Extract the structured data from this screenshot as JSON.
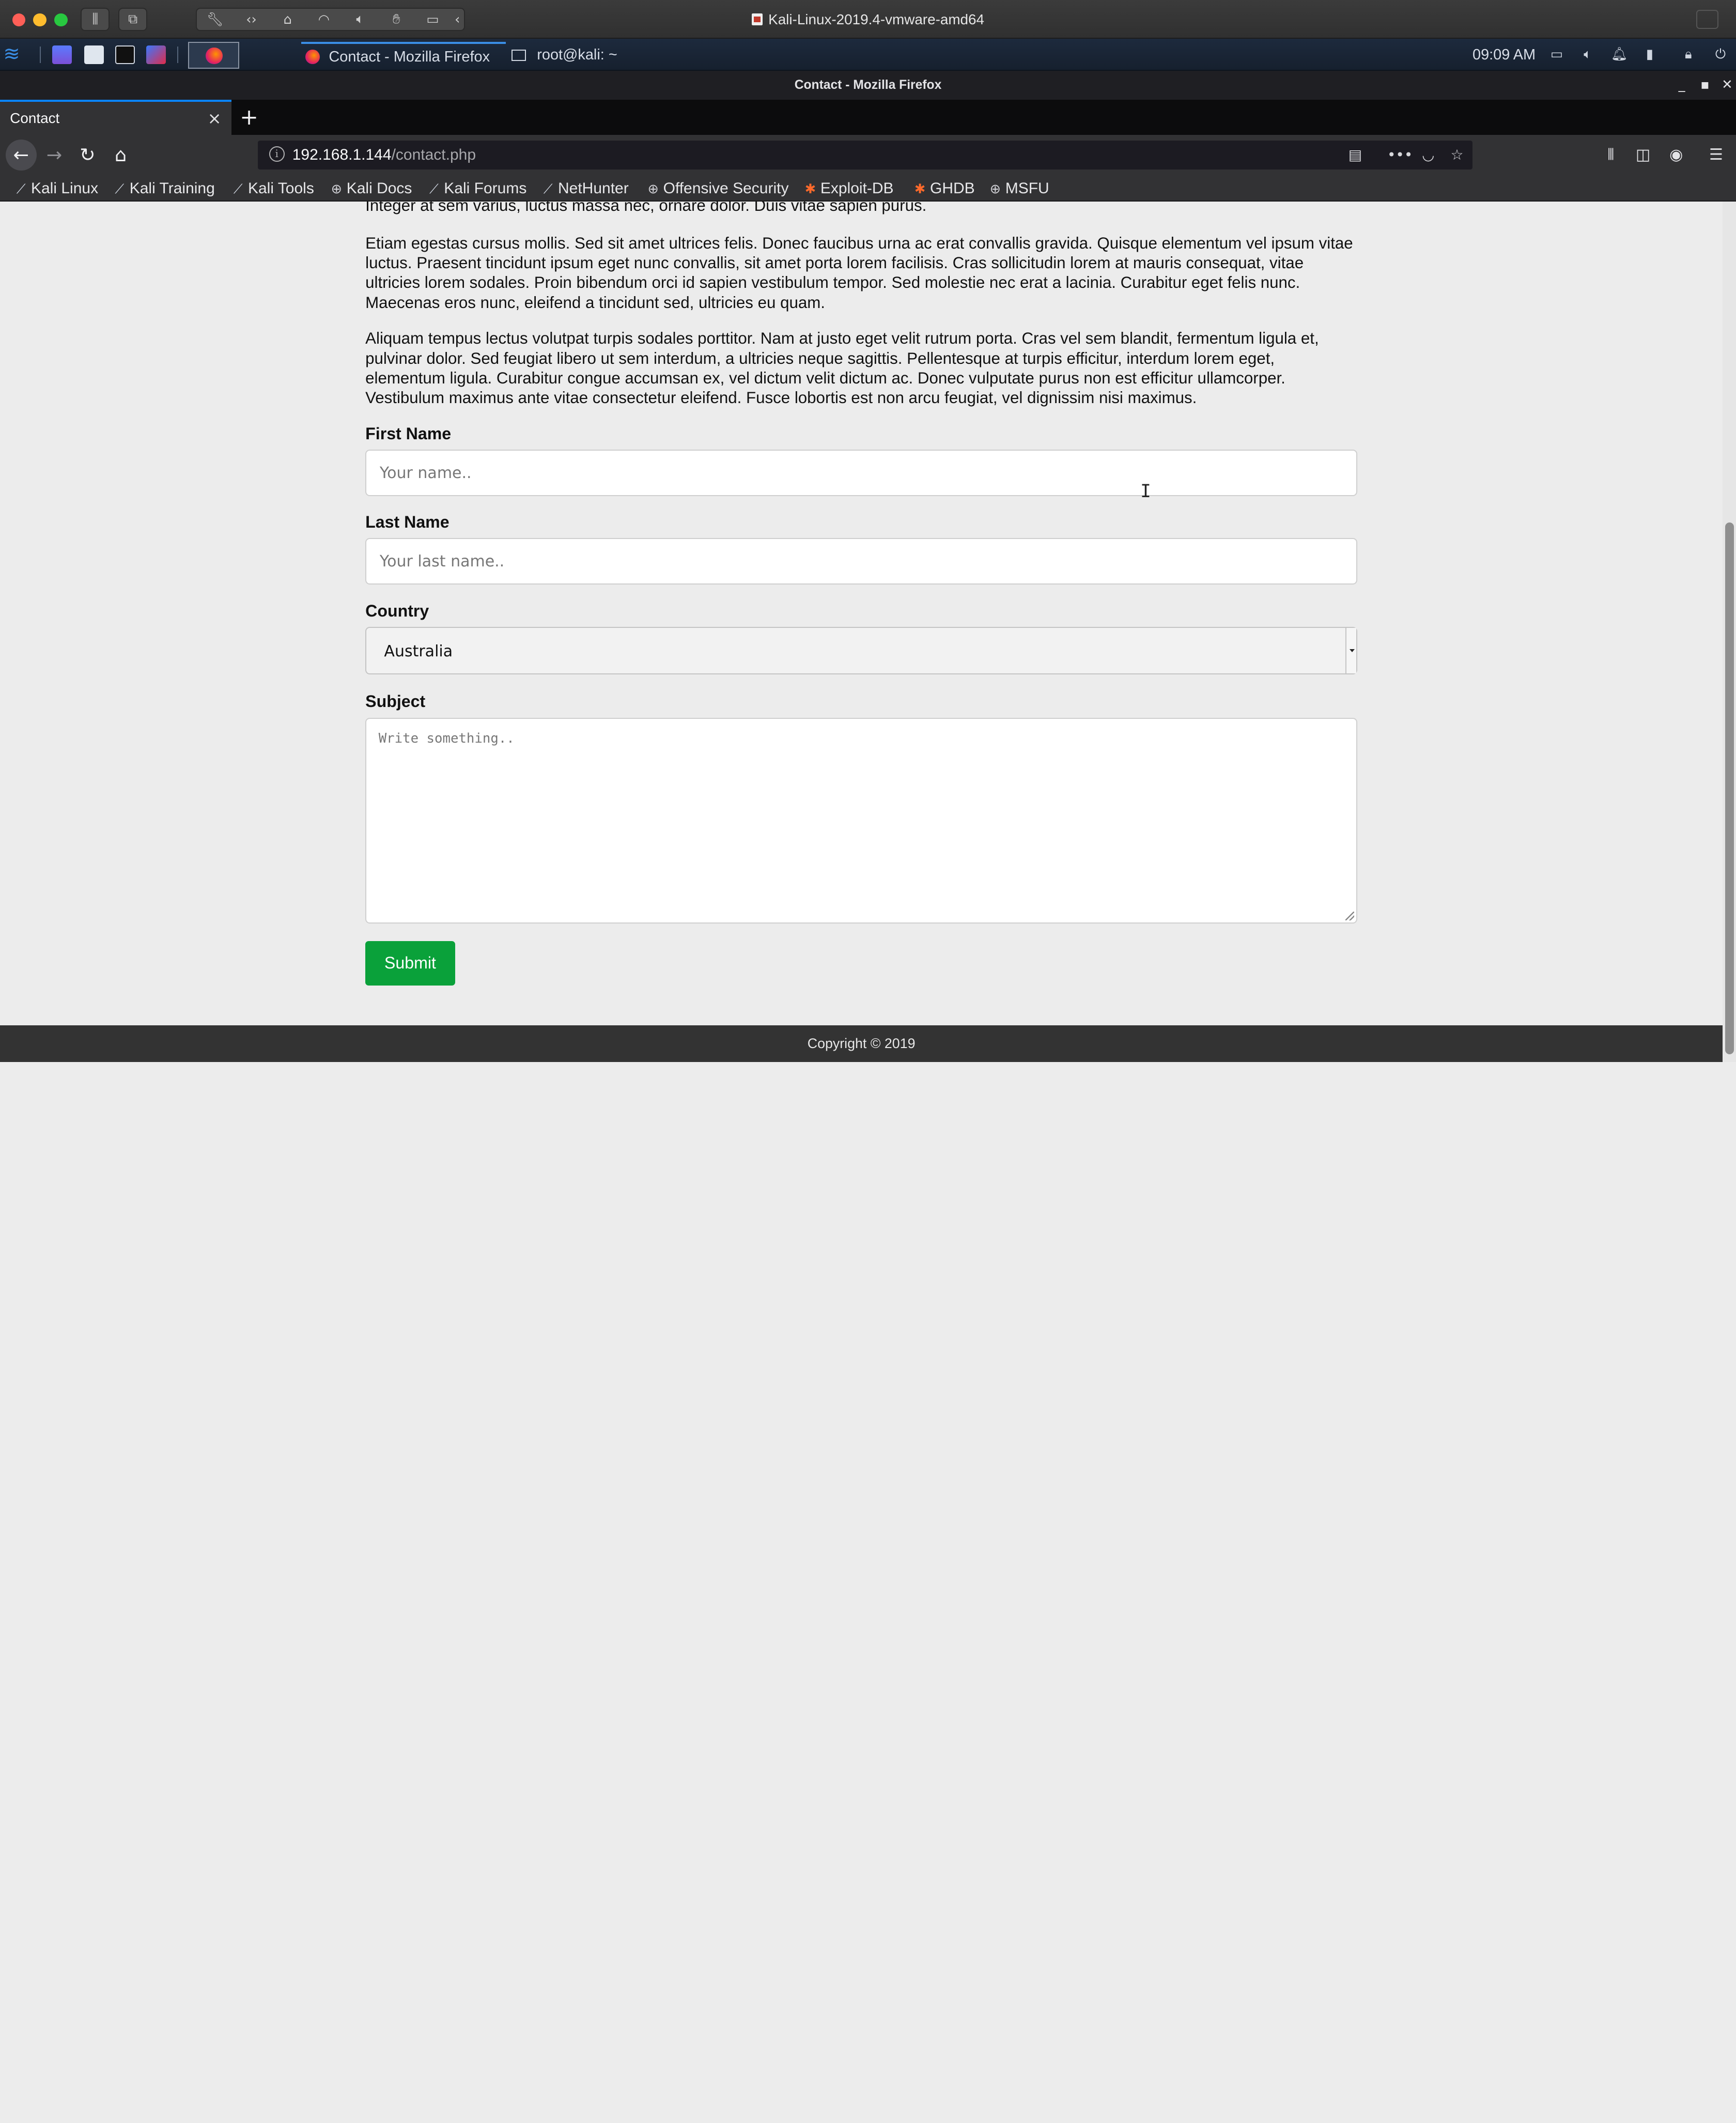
{
  "mac_window": {
    "title": "Kali-Linux-2019.4-vmware-amd64"
  },
  "kali_panel": {
    "tasks": [
      {
        "label": "Contact - Mozilla Firefox"
      },
      {
        "label": "root@kali: ~"
      }
    ],
    "clock": "09:09 AM"
  },
  "firefox": {
    "window_title": "Contact - Mozilla Firefox",
    "tab": {
      "label": "Contact",
      "close": "×"
    },
    "new_tab": "+",
    "url": {
      "host": "192.168.1.144",
      "path": "/contact.php"
    },
    "bookmarks": [
      {
        "label": "Kali Linux",
        "icon": "kali-icon"
      },
      {
        "label": "Kali Training",
        "icon": "kali-icon"
      },
      {
        "label": "Kali Tools",
        "icon": "kali-icon"
      },
      {
        "label": "Kali Docs",
        "icon": "globe-icon"
      },
      {
        "label": "Kali Forums",
        "icon": "kali-icon"
      },
      {
        "label": "NetHunter",
        "icon": "kali-icon"
      },
      {
        "label": "Offensive Security",
        "icon": "globe-icon"
      },
      {
        "label": "Exploit-DB",
        "icon": "bug-icon"
      },
      {
        "label": "GHDB",
        "icon": "bug-icon"
      },
      {
        "label": "MSFU",
        "icon": "globe-icon"
      }
    ]
  },
  "page": {
    "para_cut": "Integer at sem varius, luctus massa nec, ornare dolor. Duis vitae sapien purus.",
    "para1": "Etiam egestas cursus mollis. Sed sit amet ultrices felis. Donec faucibus urna ac erat convallis gravida. Quisque elementum vel ipsum vitae luctus. Praesent tincidunt ipsum eget nunc convallis, sit amet porta lorem facilisis. Cras sollicitudin lorem at mauris consequat, vitae ultricies lorem sodales. Proin bibendum orci id sapien vestibulum tempor. Sed molestie nec erat a lacinia. Curabitur eget felis nunc. Maecenas eros nunc, eleifend a tincidunt sed, ultricies eu quam.",
    "para2": "Aliquam tempus lectus volutpat turpis sodales porttitor. Nam at justo eget velit rutrum porta. Cras vel sem blandit, fermentum ligula et, pulvinar dolor. Sed feugiat libero ut sem interdum, a ultricies neque sagittis. Pellentesque at turpis efficitur, interdum lorem eget, elementum ligula. Curabitur congue accumsan ex, vel dictum velit dictum ac. Donec vulputate purus non est efficitur ullamcorper. Vestibulum maximus ante vitae consectetur eleifend. Fusce lobortis est non arcu feugiat, vel dignissim nisi maximus.",
    "form": {
      "first_name_label": "First Name",
      "first_name_placeholder": "Your name..",
      "last_name_label": "Last Name",
      "last_name_placeholder": "Your last name..",
      "country_label": "Country",
      "country_value": "Australia",
      "subject_label": "Subject",
      "subject_placeholder": "Write something..",
      "submit_label": "Submit"
    },
    "footer": "Copyright © 2019"
  },
  "colors": {
    "submit_bg": "#0aa13a",
    "tab_accent": "#0a84ff",
    "footer_bg": "#333333"
  }
}
